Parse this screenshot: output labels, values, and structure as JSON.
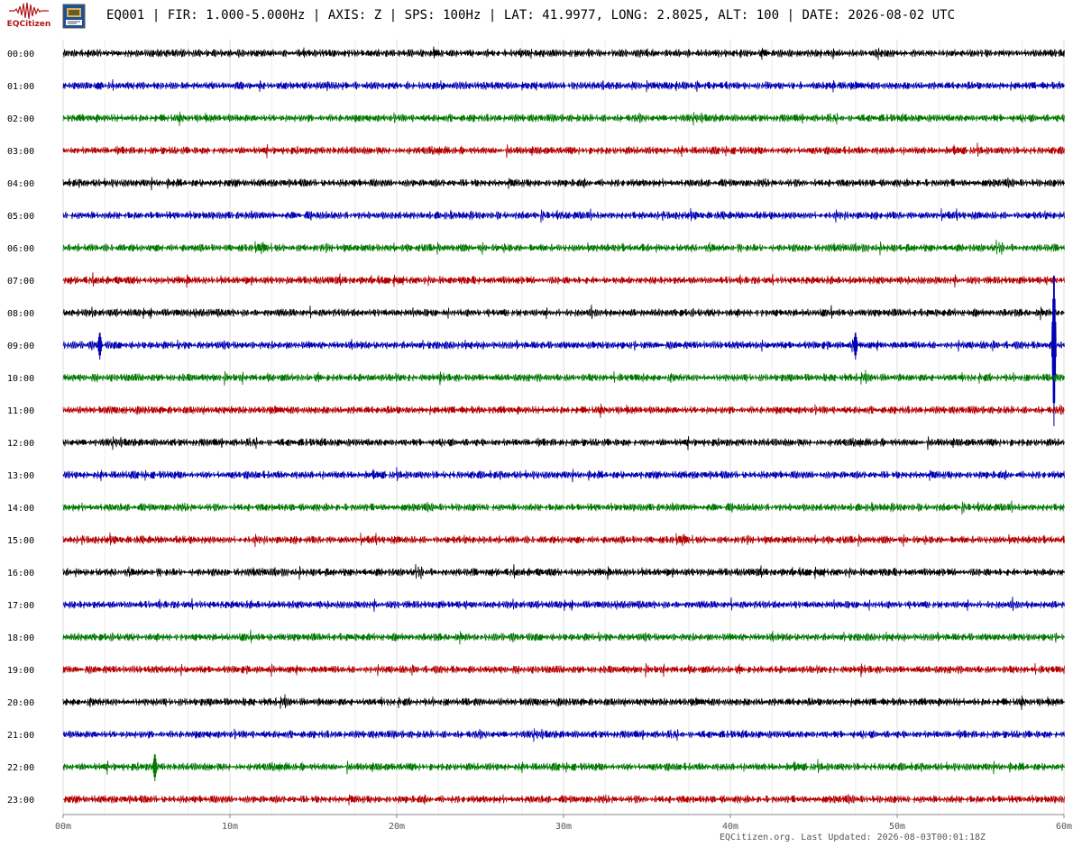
{
  "header": {
    "logo_text": "EQCitizen",
    "title": "EQ001 | FIR: 1.000-5.000Hz | AXIS: Z | SPS: 100Hz | LAT: 41.9977, LONG: 2.8025, ALT: 100 | DATE: 2026-08-02 UTC"
  },
  "footer": {
    "text": "EQCitizen.org. Last Updated: 2026-08-03T00:01:18Z"
  },
  "chart_data": {
    "type": "line",
    "description_type": "helicorder",
    "rows": [
      "00:00",
      "01:00",
      "02:00",
      "03:00",
      "04:00",
      "05:00",
      "06:00",
      "07:00",
      "08:00",
      "09:00",
      "10:00",
      "11:00",
      "12:00",
      "13:00",
      "14:00",
      "15:00",
      "16:00",
      "17:00",
      "18:00",
      "19:00",
      "20:00",
      "21:00",
      "22:00",
      "23:00"
    ],
    "x_ticks": [
      "00m",
      "10m",
      "20m",
      "30m",
      "40m",
      "50m",
      "60m"
    ],
    "xlim": [
      0,
      60
    ],
    "x_unit": "minutes",
    "row_colors": [
      "#000000",
      "#0000b4",
      "#007800",
      "#b40000"
    ],
    "grid": true,
    "events": [
      {
        "row": "09:00",
        "minute": 59.4,
        "note": "large spike spanning 07:00-11:00 traces"
      },
      {
        "row": "09:00",
        "minute": 2.2
      },
      {
        "row": "09:00",
        "minute": 47.5
      },
      {
        "row": "22:00",
        "minute": 5.5
      }
    ]
  }
}
